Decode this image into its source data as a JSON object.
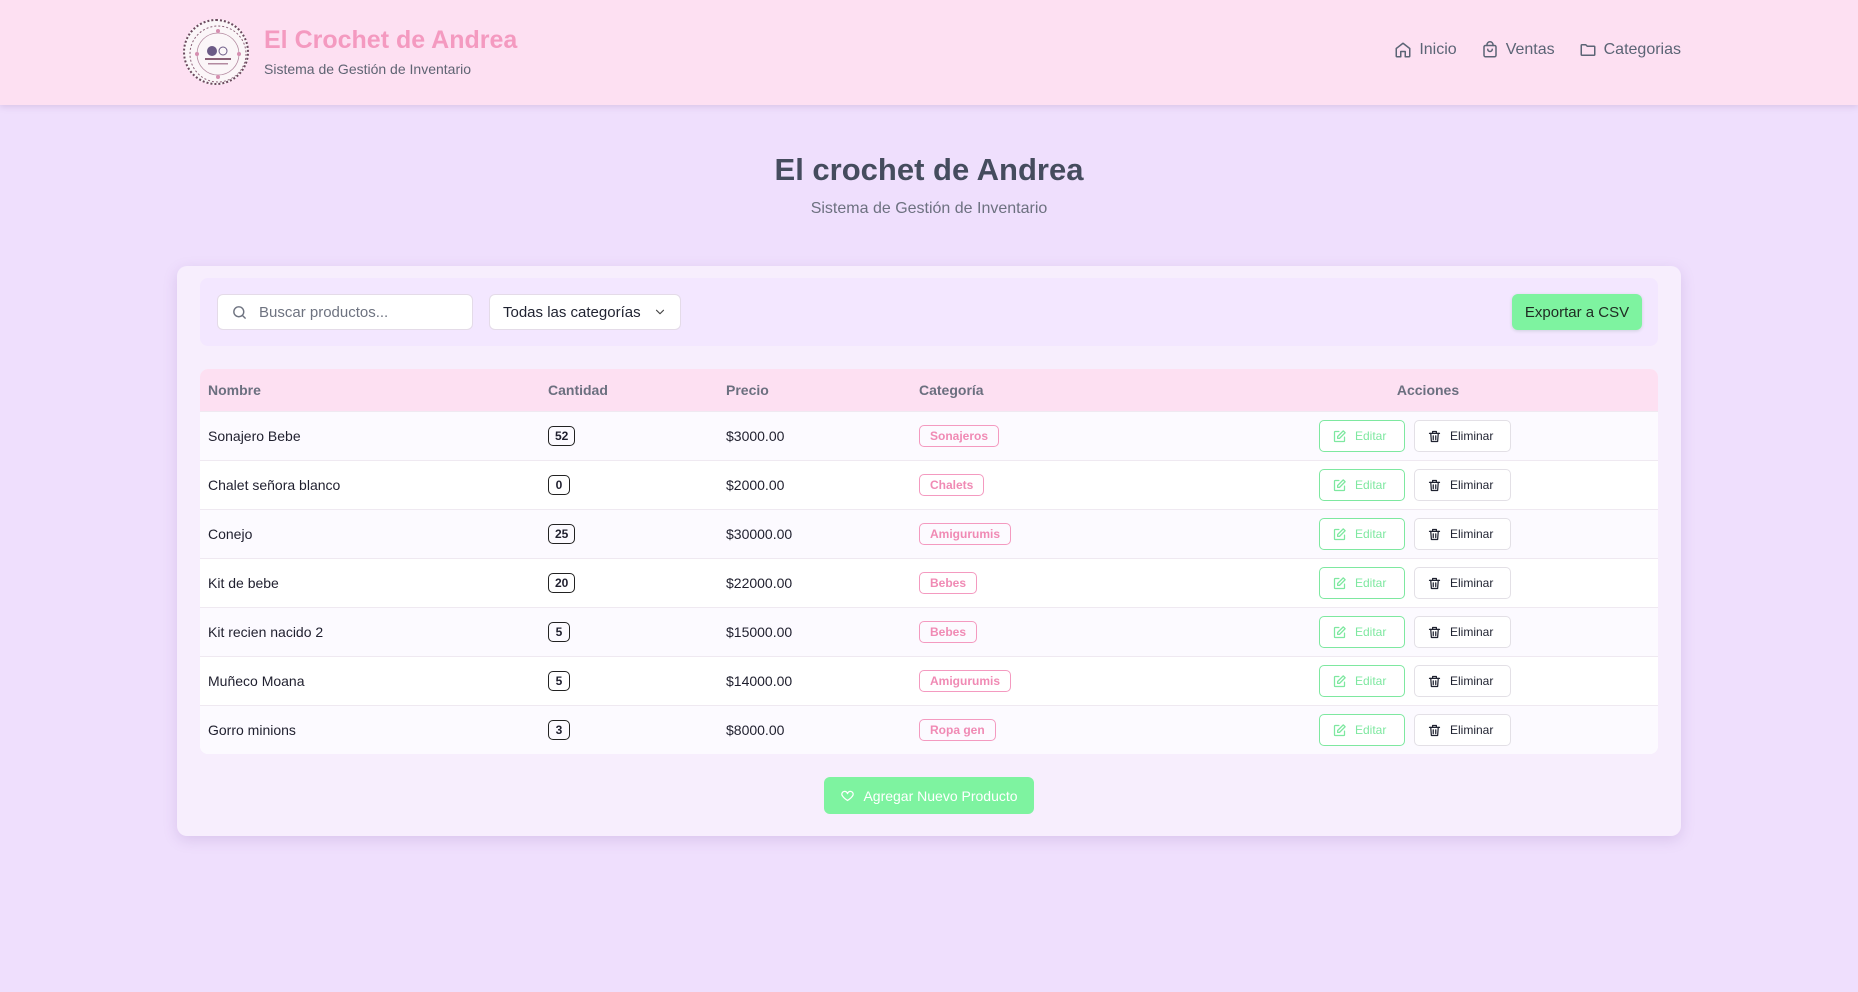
{
  "header": {
    "brand_title": "El Crochet de Andrea",
    "brand_subtitle": "Sistema de Gestión de Inventario",
    "logo_icon": "crochet-logo-seal",
    "nav": [
      {
        "label": "Inicio",
        "icon": "home-icon"
      },
      {
        "label": "Ventas",
        "icon": "shopping-bag-icon"
      },
      {
        "label": "Categorias",
        "icon": "folder-icon"
      }
    ]
  },
  "page": {
    "title": "El crochet de Andrea",
    "subtitle": "Sistema de Gestión de Inventario"
  },
  "toolbar": {
    "search_placeholder": "Buscar productos...",
    "category_selected": "Todas las categorías",
    "export_label": "Exportar a CSV"
  },
  "table": {
    "headers": {
      "name": "Nombre",
      "qty": "Cantidad",
      "price": "Precio",
      "category": "Categoría",
      "actions": "Acciones"
    },
    "edit_label": "Editar",
    "delete_label": "Eliminar",
    "rows": [
      {
        "name": "Sonajero Bebe",
        "qty": "52",
        "price": "$3000.00",
        "category": "Sonajeros"
      },
      {
        "name": "Chalet señora blanco",
        "qty": "0",
        "price": "$2000.00",
        "category": "Chalets"
      },
      {
        "name": "Conejo",
        "qty": "25",
        "price": "$30000.00",
        "category": "Amigurumis"
      },
      {
        "name": "Kit de bebe",
        "qty": "20",
        "price": "$22000.00",
        "category": "Bebes"
      },
      {
        "name": "Kit recien nacido 2",
        "qty": "5",
        "price": "$15000.00",
        "category": "Bebes"
      },
      {
        "name": "Muñeco Moana",
        "qty": "5",
        "price": "$14000.00",
        "category": "Amigurumis"
      },
      {
        "name": "Gorro minions",
        "qty": "3",
        "price": "$8000.00",
        "category": "Ropa gen"
      }
    ]
  },
  "add_button": {
    "label": "Agregar Nuevo Producto",
    "icon": "heart-icon"
  },
  "colors": {
    "header_bg": "#fde0f2",
    "page_bg": "#efdffd",
    "brand_pink": "#f49ac0",
    "accent_green": "#7ef3a0"
  }
}
